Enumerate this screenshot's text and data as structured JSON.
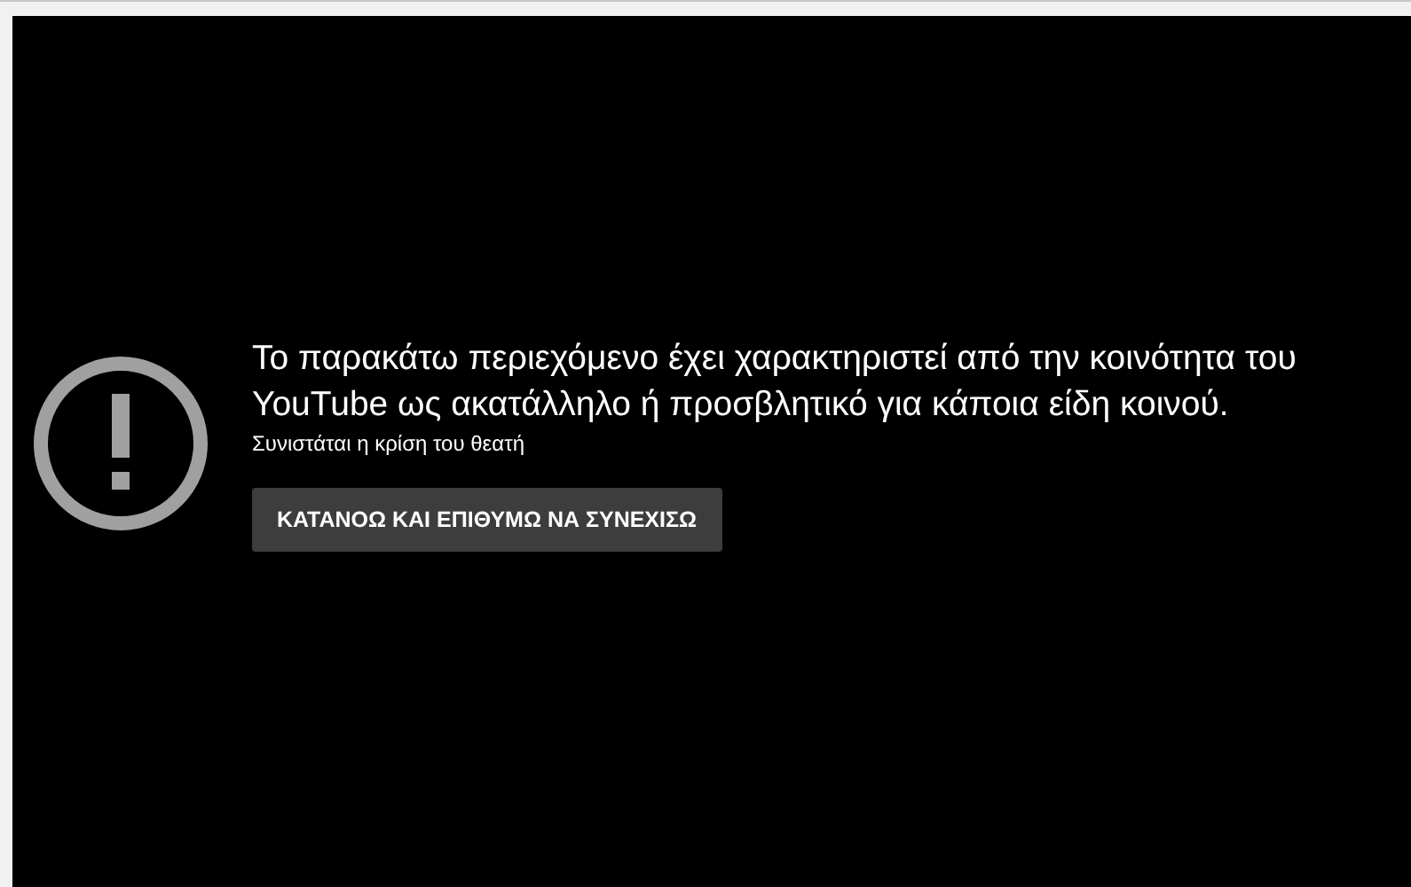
{
  "warning": {
    "message": "Το παρακάτω περιεχόμενο έχει χαρακτηριστεί από την κοινότητα του YouTube ως ακατάλληλο ή προσβλητικό για κάποια είδη κοινού.",
    "advisory": "Συνιστάται η κρίση του θεατή",
    "button": "ΚΑΤΑΝΟΩ ΚΑΙ ΕΠΙΘΥΜΩ ΝΑ ΣΥΝΕΧΙΣΩ"
  }
}
